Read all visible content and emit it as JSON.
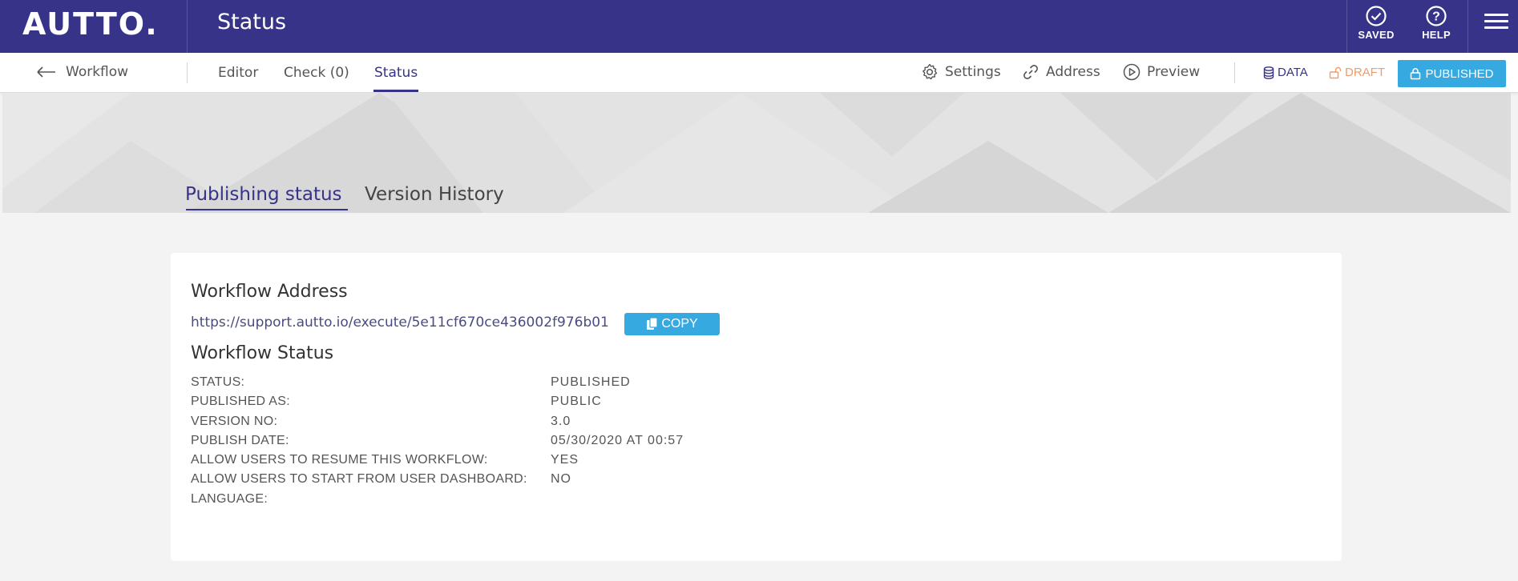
{
  "app": {
    "logo": "AUTTO.",
    "page_title": "Status",
    "saved_label": "SAVED",
    "help_label": "HELP",
    "colors": {
      "brand": "#363388",
      "accent": "#36a9e1",
      "draft": "#f29b6b"
    }
  },
  "subnav": {
    "back_label": "Workflow",
    "tabs": [
      {
        "label": "Editor"
      },
      {
        "label": "Check (0)"
      },
      {
        "label": "Status"
      }
    ],
    "settings_label": "Settings",
    "address_label": "Address",
    "preview_label": "Preview",
    "modes": {
      "data": "DATA",
      "draft": "DRAFT",
      "published": "PUBLISHED"
    }
  },
  "hero": {
    "tabs": [
      {
        "label": "Publishing status"
      },
      {
        "label": "Version History"
      }
    ]
  },
  "card": {
    "address_heading": "Workflow Address",
    "address_url": "https://support.autto.io/execute/5e11cf670ce436002f976b01",
    "copy_label": "COPY",
    "status_heading": "Workflow Status",
    "rows": [
      {
        "key": "STATUS:",
        "value": "PUBLISHED"
      },
      {
        "key": "PUBLISHED AS:",
        "value": "PUBLIC"
      },
      {
        "key": "VERSION NO:",
        "value": "3.0"
      },
      {
        "key": "PUBLISH DATE:",
        "value": "05/30/2020 AT 00:57"
      },
      {
        "key": "ALLOW USERS TO RESUME THIS WORKFLOW:",
        "value": "YES"
      },
      {
        "key": "ALLOW USERS TO START FROM USER DASHBOARD:",
        "value": "NO"
      },
      {
        "key": "LANGUAGE:",
        "value": ""
      }
    ]
  }
}
